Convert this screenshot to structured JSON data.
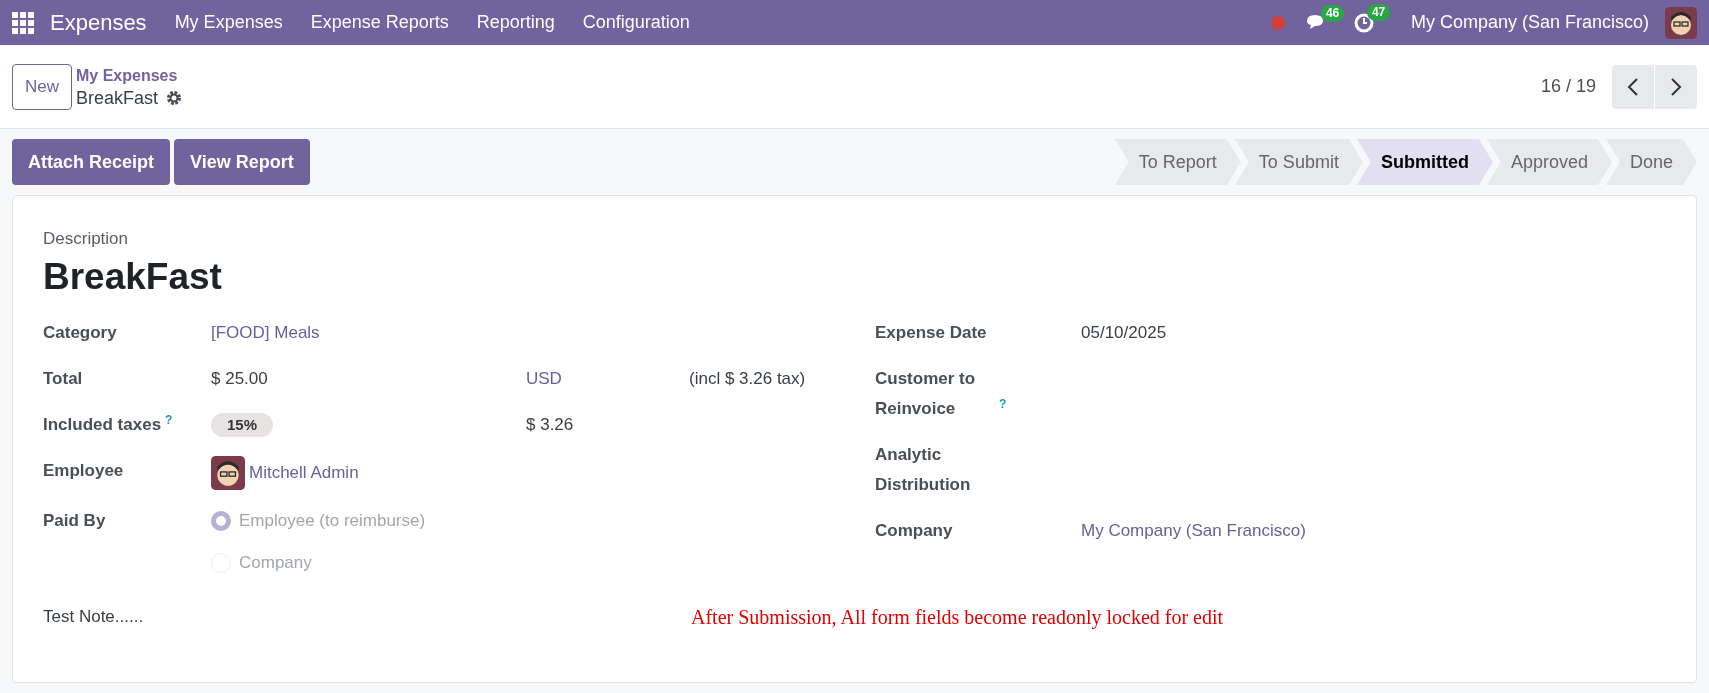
{
  "navbar": {
    "app_name": "Expenses",
    "menu": [
      "My Expenses",
      "Expense Reports",
      "Reporting",
      "Configuration"
    ],
    "messages_count": "46",
    "activities_count": "47",
    "company": "My Company (San Francisco)"
  },
  "control_panel": {
    "new_button": "New",
    "breadcrumb_parent": "My Expenses",
    "record_name": "BreakFast",
    "pager": "16 / 19"
  },
  "action_buttons": [
    "Attach Receipt",
    "View Report"
  ],
  "stages": [
    {
      "label": "To Report",
      "selected": false
    },
    {
      "label": "To Submit",
      "selected": false
    },
    {
      "label": "Submitted",
      "selected": true
    },
    {
      "label": "Approved",
      "selected": false
    },
    {
      "label": "Done",
      "selected": false
    }
  ],
  "form": {
    "description_label": "Description",
    "title": "BreakFast",
    "left_fields": [
      {
        "kind": "link",
        "label": "Category",
        "value": "[FOOD] Meals"
      },
      {
        "kind": "amount",
        "label": "Total",
        "value": "$ 25.00",
        "currency": "USD",
        "tax_note": "(incl $ 3.26 tax)"
      },
      {
        "kind": "tags",
        "label": "Included taxes",
        "help": "?",
        "tag": "15%",
        "amount": "$ 3.26"
      },
      {
        "kind": "employee",
        "label": "Employee",
        "value": "Mitchell Admin"
      },
      {
        "kind": "radio",
        "label": "Paid By",
        "options": [
          {
            "label": "Employee (to reimburse)",
            "selected": true
          },
          {
            "label": "Company",
            "selected": false
          }
        ]
      }
    ],
    "right_fields": [
      {
        "kind": "text",
        "label": "Expense Date",
        "value": "05/10/2025"
      },
      {
        "kind": "empty",
        "label": "Customer to Reinvoice",
        "help": "?"
      },
      {
        "kind": "empty",
        "label": "Analytic Distribution"
      },
      {
        "kind": "link",
        "label": "Company",
        "value": "My Company (San Francisco)"
      }
    ],
    "note": "Test Note......",
    "annotation": "After Submission, All form fields become readonly locked for edit"
  }
}
